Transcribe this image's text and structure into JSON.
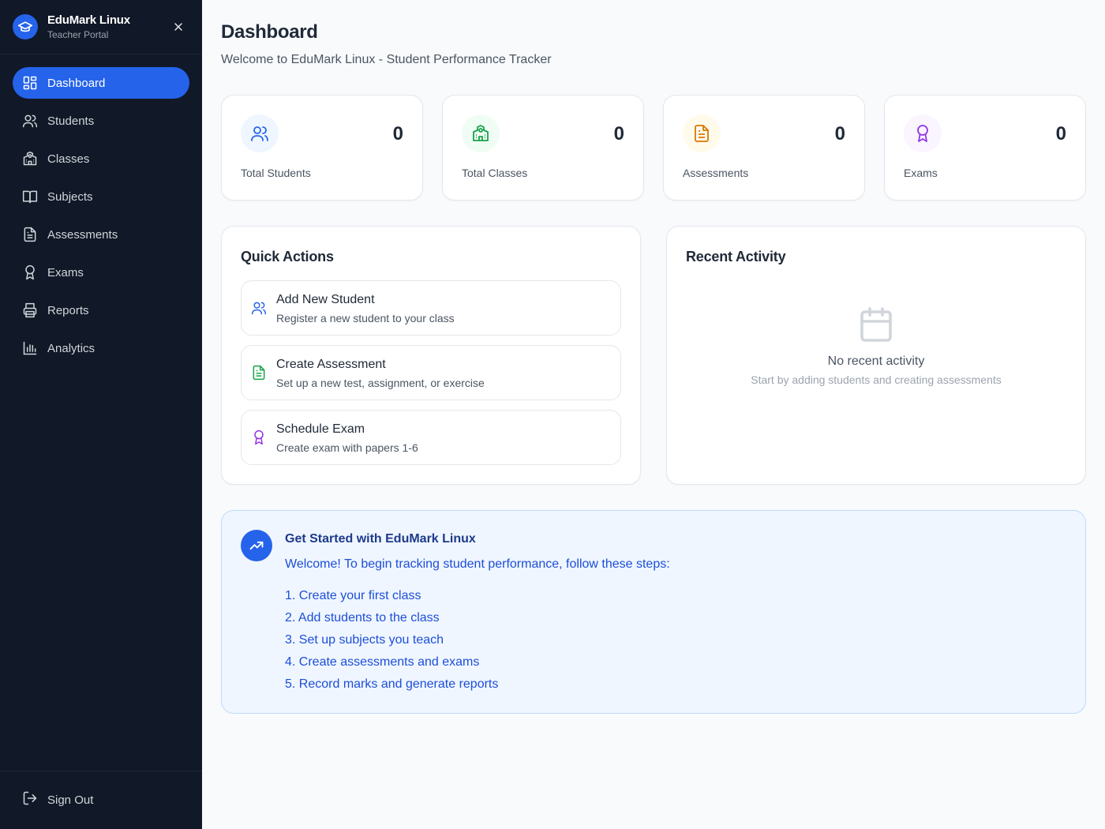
{
  "sidebar": {
    "brand_title": "EduMark Linux",
    "brand_subtitle": "Teacher Portal",
    "items": [
      {
        "label": "Dashboard",
        "icon": "dashboard-icon",
        "active": true
      },
      {
        "label": "Students",
        "icon": "users-icon"
      },
      {
        "label": "Classes",
        "icon": "school-icon"
      },
      {
        "label": "Subjects",
        "icon": "book-icon"
      },
      {
        "label": "Assessments",
        "icon": "document-icon"
      },
      {
        "label": "Exams",
        "icon": "award-icon"
      },
      {
        "label": "Reports",
        "icon": "printer-icon"
      },
      {
        "label": "Analytics",
        "icon": "bar-chart-icon"
      }
    ],
    "signout_label": "Sign Out"
  },
  "header": {
    "title": "Dashboard",
    "subtitle": "Welcome to EduMark Linux - Student Performance Tracker"
  },
  "stats": [
    {
      "label": "Total Students",
      "value": "0",
      "icon": "users-icon",
      "color": "#2563eb"
    },
    {
      "label": "Total Classes",
      "value": "0",
      "icon": "school-icon",
      "color": "#16a34a"
    },
    {
      "label": "Assessments",
      "value": "0",
      "icon": "document-icon",
      "color": "#d97706"
    },
    {
      "label": "Exams",
      "value": "0",
      "icon": "award-icon",
      "color": "#9333ea"
    }
  ],
  "quick_actions": {
    "title": "Quick Actions",
    "items": [
      {
        "title": "Add New Student",
        "desc": "Register a new student to your class",
        "icon": "users-icon",
        "color": "#2563eb"
      },
      {
        "title": "Create Assessment",
        "desc": "Set up a new test, assignment, or exercise",
        "icon": "document-icon",
        "color": "#16a34a"
      },
      {
        "title": "Schedule Exam",
        "desc": "Create exam with papers 1-6",
        "icon": "award-icon",
        "color": "#9333ea"
      }
    ]
  },
  "recent_activity": {
    "title": "Recent Activity",
    "empty_title": "No recent activity",
    "empty_subtitle": "Start by adding students and creating assessments"
  },
  "get_started": {
    "title": "Get Started with EduMark Linux",
    "intro": "Welcome! To begin tracking student performance, follow these steps:",
    "steps": [
      "1. Create your first class",
      "2. Add students to the class",
      "3. Set up subjects you teach",
      "4. Create assessments and exams",
      "5. Record marks and generate reports"
    ]
  },
  "colors": {
    "accent": "#2563eb",
    "sidebar_bg": "#111827"
  }
}
